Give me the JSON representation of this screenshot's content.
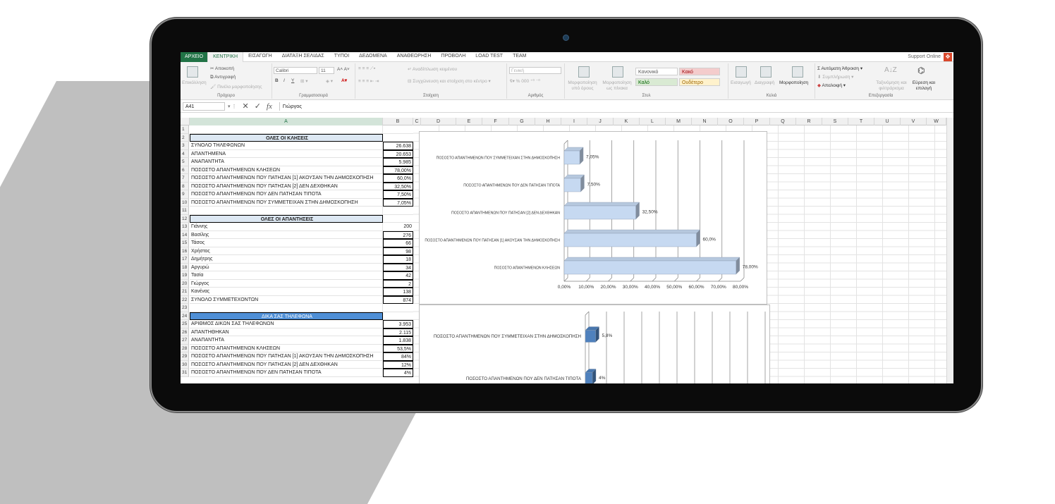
{
  "ribbon_tabs": {
    "file": "ΑΡΧΕΙΟ",
    "items": [
      "ΚΕΝΤΡΙΚΗ",
      "ΕΙΣΑΓΩΓΗ",
      "ΔΙΑΤΑΞΗ ΣΕΛΙΔΑΣ",
      "ΤΥΠΟΙ",
      "ΔΕΔΟΜΕΝΑ",
      "ΑΝΑΘΕΩΡΗΣΗ",
      "ΠΡΟΒΟΛΗ",
      "LOAD TEST",
      "TEAM"
    ],
    "support": "Support Online"
  },
  "clipboard": {
    "paste": "Επικόλληση",
    "cut": "Αποκοπή",
    "copy": "Αντιγραφή",
    "painter": "Πινέλο μορφοποίησης",
    "label": "Πρόχειρο"
  },
  "font": {
    "name": "Calibri",
    "size": "11",
    "label": "Γραμματοσειρά",
    "bold": "Β",
    "italic": "Ι",
    "underline": "Υ"
  },
  "alignment": {
    "wrap": "Αναδίπλωση κειμένου",
    "merge": "Συγχώνευση και στοίχιση στο κέντρο",
    "label": "Στοίχιση"
  },
  "number": {
    "format": "Γενική",
    "label": "Αριθμός"
  },
  "styles": {
    "conditional": "Μορφοποίηση υπό όρους",
    "table": "Μορφοποίηση ως πίνακα",
    "normal": "Κανονικό",
    "bad": "Κακό",
    "good": "Καλό",
    "neutral": "Ουδέτερο",
    "label": "Στυλ"
  },
  "cells": {
    "insert": "Εισαγωγή",
    "delete": "Διαγραφή",
    "format": "Μορφοποίηση",
    "label": "Κελιά"
  },
  "editing": {
    "autosum": "Αυτόματη Άθροιση",
    "fill": "Συμπλήρωση",
    "clear": "Απαλοιφή",
    "sort": "Ταξινόμηση και φιλτράρισμα",
    "find": "Εύρεση και επιλογή",
    "label": "Επεξεργασία"
  },
  "formula_bar": {
    "namebox": "A41",
    "fx": "fx",
    "value": "Γιώργος"
  },
  "columns": [
    "A",
    "B",
    "C",
    "D",
    "E",
    "F",
    "G",
    "H",
    "I",
    "J",
    "K",
    "L",
    "M",
    "N",
    "O",
    "P",
    "Q",
    "R",
    "S",
    "T",
    "U",
    "V",
    "W"
  ],
  "rows": [
    {
      "n": "1",
      "a": "",
      "b": "",
      "type": "blank"
    },
    {
      "n": "2",
      "a": "ΟΛΕΣ ΟΙ ΚΛΗΣΕΙΣ",
      "b": "",
      "type": "header"
    },
    {
      "n": "3",
      "a": "ΣΥΝΟΛΟ ΤΗΛΕΦΩΝΩΝ",
      "b": "26.638"
    },
    {
      "n": "4",
      "a": "ΑΠΑΝΤΗΜΕΝΑ",
      "b": "20.653"
    },
    {
      "n": "5",
      "a": "ΑΝΑΠΑΝΤΗΤΑ",
      "b": "5.985"
    },
    {
      "n": "6",
      "a": "ΠΟΣΟΣΤΟ ΑΠΑΝΤΗΜΕΝΩΝ ΚΛΗΣΕΩΝ",
      "b": "78,00%"
    },
    {
      "n": "7",
      "a": "ΠΟΣΟΣΤΟ ΑΠΑΝΤΗΜΕΝΩΝ ΠΟΥ ΠΑΤΗΣΑΝ [1] ΑΚΟΥΣΑΝ ΤΗΝ ΔΗΜΟΣΚΟΠΗΣΗ",
      "b": "60,0%"
    },
    {
      "n": "8",
      "a": "ΠΟΣΟΣΤΟ ΑΠΑΝΤΗΜΕΝΩΝ ΠΟΥ ΠΑΤΗΣΑΝ [2] ΔΕΝ ΔΕΧΘΗΚΑΝ",
      "b": "32,50%"
    },
    {
      "n": "9",
      "a": "ΠΟΣΟΣΤΟ ΑΠΑΝΤΗΜΕΝΩΝ ΠΟΥ ΔΕΝ ΠΑΤΗΣΑΝ ΤΙΠΟΤΑ",
      "b": "7,50%"
    },
    {
      "n": "10",
      "a": "ΠΟΣΟΣΤΟ ΑΠΑΝΤΗΜΕΝΩΝ ΠΟΥ ΣΥΜΜΕΤΕΙΧΑΝ ΣΤΗΝ ΔΗΜΟΣΚΟΠΗΣΗ",
      "b": "7,05%"
    },
    {
      "n": "11",
      "a": "",
      "b": "",
      "type": "blank"
    },
    {
      "n": "12",
      "a": "ΟΛΕΣ ΟΙ ΑΠΑΝΤΗΣΕΙΣ",
      "b": "",
      "type": "header"
    },
    {
      "n": "13",
      "a": "Γιάννης",
      "b": "200"
    },
    {
      "n": "14",
      "a": "Βασίλης",
      "b": "276"
    },
    {
      "n": "15",
      "a": "Τάσος",
      "b": "66"
    },
    {
      "n": "16",
      "a": "Χρήστος",
      "b": "98"
    },
    {
      "n": "17",
      "a": "Δημήτρης",
      "b": "18"
    },
    {
      "n": "18",
      "a": "Αργυρώ",
      "b": "34"
    },
    {
      "n": "19",
      "a": "Τασία",
      "b": "42"
    },
    {
      "n": "20",
      "a": "Γιώργος",
      "b": "2"
    },
    {
      "n": "21",
      "a": "Κανένας",
      "b": "138"
    },
    {
      "n": "22",
      "a": "ΣΥΝΟΛΟ ΣΥΜΜΕΤΕΧΟΝΤΩΝ",
      "b": "874"
    },
    {
      "n": "23",
      "a": "",
      "b": "",
      "type": "blank"
    },
    {
      "n": "24",
      "a": "ΔΙΚΑ ΣΑΣ ΤΗΛΕΦΩΝΑ",
      "b": "",
      "type": "header2"
    },
    {
      "n": "25",
      "a": "ΑΡΙΘΜΟΣ ΔΙΚΩΝ ΣΑΣ ΤΗΛΕΦΩΝΩΝ",
      "b": "3.953"
    },
    {
      "n": "26",
      "a": "ΑΠΑΝΤΗΘΗΚΑΝ",
      "b": "2.115"
    },
    {
      "n": "27",
      "a": "ΑΝΑΠΑΝΤΗΤΑ",
      "b": "1.838"
    },
    {
      "n": "28",
      "a": "ΠΟΣΟΣΤΟ ΑΠΑΝΤΗΜΕΝΩΝ ΚΛΗΣΕΩΝ",
      "b": "53,5%"
    },
    {
      "n": "29",
      "a": "ΠΟΣΟΣΤΟ ΑΠΑΝΤΗΜΕΝΩΝ ΠΟΥ ΠΑΤΗΣΑΝ [1] ΑΚΟΥΣΑΝ ΤΗΝ ΔΗΜΟΣΚΟΠΗΣΗ",
      "b": "84%"
    },
    {
      "n": "30",
      "a": "ΠΟΣΟΣΤΟ ΑΠΑΝΤΗΜΕΝΩΝ ΠΟΥ ΠΑΤΗΣΑΝ [2] ΔΕΝ ΔΕΧΘΗΚΑΝ",
      "b": "12%"
    },
    {
      "n": "31",
      "a": "ΠΟΣΟΣΤΟ ΑΠΑΝΤΗΜΕΝΩΝ ΠΟΥ ΔΕΝ ΠΑΤΗΣΑΝ ΤΙΠΟΤΑ",
      "b": "4%"
    }
  ],
  "chart_data": [
    {
      "type": "bar",
      "orientation": "horizontal",
      "categories": [
        "ΠΟΣΟΣΤΟ ΑΠΑΝΤΗΜΕΝΩΝ ΠΟΥ ΣΥΜΜΕΤΕΙΧΑΝ ΣΤΗΝ ΔΗΜΟΣΚΟΠΗΣΗ",
        "ΠΟΣΟΣΤΟ ΑΠΑΝΤΗΜΕΝΩΝ ΠΟΥ ΔΕΝ ΠΑΤΗΣΑΝ ΤΙΠΟΤΑ",
        "ΠΟΣΟΣΤΟ ΑΠΑΝΤΗΜΕΝΩΝ ΠΟΥ ΠΑΤΗΣΑΝ [2] ΔΕΝ ΔΕΧΘΗΚΑΝ",
        "ΠΟΣΟΣΤΟ ΑΠΑΝΤΗΜΕΝΩΝ ΠΟΥ ΠΑΤΗΣΑΝ [1] ΑΚΟΥΣΑΝ ΤΗΝ ΔΗΜΟΣΚΟΠΗΣΗ",
        "ΠΟΣΟΣΤΟ ΑΠΑΝΤΗΜΕΝΩΝ ΚΛΗΣΕΩΝ"
      ],
      "values": [
        7.05,
        7.5,
        32.5,
        60,
        78
      ],
      "data_labels": [
        "7,05%",
        "7,50%",
        "32,50%",
        "60,0%",
        "78,00%"
      ],
      "xlim": [
        0,
        80
      ],
      "ticks": [
        "0,00%",
        "10,00%",
        "20,00%",
        "30,00%",
        "40,00%",
        "50,00%",
        "60,00%",
        "70,00%",
        "80,00%"
      ],
      "color": "#c6d9f1",
      "grid": true
    },
    {
      "type": "bar",
      "orientation": "horizontal",
      "categories": [
        "ΠΟΣΟΣΤΟ ΑΠΑΝΤΗΜΕΝΩΝ ΠΟΥ ΣΥΜΜΕΤΕΙΧΑΝ ΣΤΗΝ ΔΗΜΟΣΚΟΠΗΣΗ",
        "ΠΟΣΟΣΤΟ ΑΠΑΝΤΗΜΕΝΩΝ ΠΟΥ ΔΕΝ ΠΑΤΗΣΑΝ ΤΙΠΟΤΑ"
      ],
      "values": [
        5.8,
        4
      ],
      "data_labels": [
        "5,8%",
        "4%"
      ],
      "xlim": [
        0,
        100
      ],
      "color": "#4f81bd",
      "grid": true
    }
  ]
}
